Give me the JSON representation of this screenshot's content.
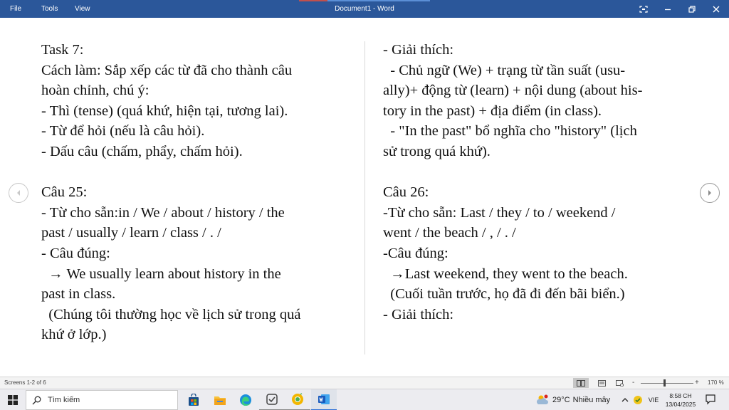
{
  "window": {
    "title": "Document1 - Word",
    "menu": {
      "file": "File",
      "tools": "Tools",
      "view": "View"
    }
  },
  "document": {
    "left_column": [
      "Task 7:",
      "Cách làm: Sắp xếp các từ đã cho thành câu",
      "hoàn chỉnh, chú ý:",
      "- Thì (tense) (quá khứ, hiện tại, tương lai).",
      "- Từ để hỏi (nếu là câu hỏi).",
      "- Dấu câu (chấm, phẩy, chấm hỏi).",
      "",
      "Câu 25:",
      "- Từ cho sẵn:in / We / about / history / the",
      "past / usually / learn / class / . /",
      "- Câu đúng:",
      "  → We usually learn about history in the",
      "past in class.",
      "  (Chúng tôi thường học về lịch sử trong quá",
      "khứ ở lớp.)"
    ],
    "right_column": [
      "- Giải thích:",
      "  - Chủ ngữ (We) + trạng từ tần suất (usu-",
      "ally)+ động từ (learn) + nội dung (about his-",
      "tory in the past) + địa điểm (in class).",
      "  - \"In the past\" bổ nghĩa cho \"history\" (lịch",
      "sử trong quá khứ).",
      "",
      "Câu 26:",
      "-Từ cho sẵn: Last / they / to / weekend /",
      "went / the beach / , / . /",
      "-Câu đúng:",
      "  →Last weekend, they went to the beach.",
      "  (Cuối tuần trước, họ đã đi đến bãi biển.)",
      "- Giải thích:"
    ]
  },
  "statusbar": {
    "screens": "Screens 1-2 of 6",
    "zoom_minus": "-",
    "zoom_plus": "+",
    "zoom_level": "170 %",
    "zoom_slider_fraction": 0.45
  },
  "taskbar": {
    "search_label": "Tìm kiếm",
    "weather_temp": "29°C",
    "weather_desc": "Nhiều mây",
    "language": "VIE",
    "time": "8:58 CH",
    "date": "13/04/2025",
    "apps": [
      "store-icon",
      "file-explorer-icon",
      "edge-icon",
      "snipping-tool-icon",
      "chrome-canary-icon",
      "word-icon"
    ]
  },
  "colors": {
    "title_bar": "#2b579a",
    "taskbar": "#ececf0",
    "accent": "#2b6fd6"
  }
}
